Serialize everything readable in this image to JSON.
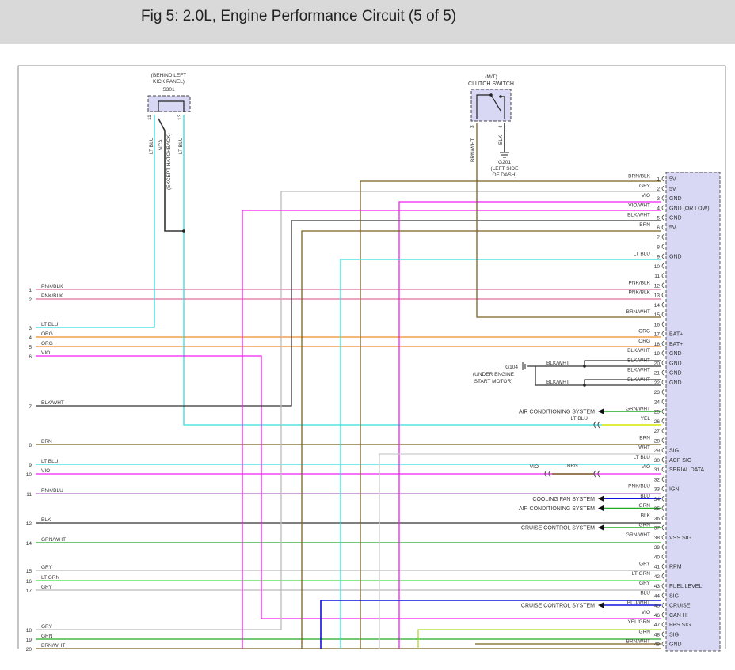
{
  "page": {
    "title": "Fig 5: 2.0L, Engine Performance Circuit (5 of 5)"
  },
  "colors": {
    "header_bg": "#d9d9d9",
    "connector_fill": "#d8d8f4",
    "PNK": "#e0709c",
    "LT_BLU": "#33dddd",
    "ORG": "#f08c28",
    "VIO": "#f01ef0",
    "BLK": "#333333",
    "BRN": "#7a6222",
    "GRN": "#22aa22",
    "GRY": "#bbbbbb",
    "WHT": "#cccccc",
    "YEL": "#e8e800",
    "LT_GRN": "#44dd44",
    "BLU": "#1111dd",
    "GRY_BLK": "#888888"
  },
  "splice_s301": {
    "label": [
      "(BEHIND LEFT",
      "KICK PANEL)",
      "S301"
    ],
    "pins": [
      "11",
      "13"
    ],
    "wires": [
      "LT BLU",
      "NCA",
      "(EXCEPT HATCHBACK)",
      "LT BLU"
    ]
  },
  "clutch_switch": {
    "label": [
      "(M/T)",
      "CLUTCH SWITCH"
    ],
    "pins": [
      "3",
      "4"
    ],
    "wires": [
      "BRN/WHT",
      "BLK"
    ],
    "ground": [
      "G201",
      "(LEFT SIDE",
      "OF DASH)"
    ]
  },
  "ground_g104": {
    "label": [
      "G104",
      "(UNDER ENGINE",
      "START MOTOR)"
    ],
    "wires": [
      "BLK/WHT",
      "BLK/WHT"
    ]
  },
  "left_pins": [
    {
      "n": "1",
      "color": "PNK/BLK"
    },
    {
      "n": "2",
      "color": "PNK/BLK"
    },
    {
      "n": "3",
      "color": "LT BLU"
    },
    {
      "n": "4",
      "color": "ORG"
    },
    {
      "n": "5",
      "color": "ORG"
    },
    {
      "n": "6",
      "color": "VIO"
    },
    {
      "n": "7",
      "color": "BLK/WHT"
    },
    {
      "n": "8",
      "color": "BRN"
    },
    {
      "n": "9",
      "color": "LT BLU"
    },
    {
      "n": "10",
      "color": "VIO"
    },
    {
      "n": "11",
      "color": "PNK/BLU"
    },
    {
      "n": "12",
      "color": "BLK"
    },
    {
      "n": "14",
      "color": "GRN/WHT"
    },
    {
      "n": "15",
      "color": "GRY"
    },
    {
      "n": "16",
      "color": "LT GRN"
    },
    {
      "n": "17",
      "color": "GRY"
    },
    {
      "n": "18",
      "color": "GRY"
    },
    {
      "n": "19",
      "color": "GRN"
    },
    {
      "n": "20",
      "color": "BRN/WHT"
    }
  ],
  "right_pins": [
    {
      "n": "1",
      "color": "BRN/BLK"
    },
    {
      "n": "2",
      "color": "GRY"
    },
    {
      "n": "3",
      "color": "VIO"
    },
    {
      "n": "4",
      "color": "VIO/WHT"
    },
    {
      "n": "5",
      "color": "BLK/WHT"
    },
    {
      "n": "6",
      "color": "BRN"
    },
    {
      "n": "7",
      "color": ""
    },
    {
      "n": "8",
      "color": ""
    },
    {
      "n": "9",
      "color": "LT BLU"
    },
    {
      "n": "10",
      "color": ""
    },
    {
      "n": "11",
      "color": ""
    },
    {
      "n": "12",
      "color": "PNK/BLK"
    },
    {
      "n": "13",
      "color": "PNK/BLK"
    },
    {
      "n": "14",
      "color": ""
    },
    {
      "n": "15",
      "color": "BRN/WHT"
    },
    {
      "n": "16",
      "color": ""
    },
    {
      "n": "17",
      "color": "ORG"
    },
    {
      "n": "18",
      "color": "ORG"
    },
    {
      "n": "19",
      "color": "BLK/WHT"
    },
    {
      "n": "20",
      "color": "BLK/WHT"
    },
    {
      "n": "21",
      "color": "BLK/WHT"
    },
    {
      "n": "22",
      "color": "BLK/WHT"
    },
    {
      "n": "23",
      "color": ""
    },
    {
      "n": "24",
      "color": ""
    },
    {
      "n": "25",
      "color": "GRN/WHT"
    },
    {
      "n": "26",
      "color": "YEL"
    },
    {
      "n": "27",
      "color": ""
    },
    {
      "n": "28",
      "color": "BRN"
    },
    {
      "n": "29",
      "color": "WHT"
    },
    {
      "n": "30",
      "color": "LT BLU"
    },
    {
      "n": "31",
      "color": "VIO"
    },
    {
      "n": "32",
      "color": ""
    },
    {
      "n": "33",
      "color": "PNK/BLU"
    },
    {
      "n": "34",
      "color": "BLU"
    },
    {
      "n": "35",
      "color": "GRN"
    },
    {
      "n": "36",
      "color": "BLK"
    },
    {
      "n": "37",
      "color": "GRN"
    },
    {
      "n": "38",
      "color": "GRN/WHT"
    },
    {
      "n": "39",
      "color": ""
    },
    {
      "n": "40",
      "color": ""
    },
    {
      "n": "41",
      "color": "GRY"
    },
    {
      "n": "42",
      "color": "LT GRN"
    },
    {
      "n": "43",
      "color": "GRY"
    },
    {
      "n": "44",
      "color": "BLU"
    },
    {
      "n": "45",
      "color": "BLU/WHT"
    },
    {
      "n": "46",
      "color": "VIO"
    },
    {
      "n": "47",
      "color": "YEL/GRN"
    },
    {
      "n": "48",
      "color": "GRN"
    },
    {
      "n": "49",
      "color": "BRN/WHT"
    }
  ],
  "pcm_functions": [
    {
      "pin": "1",
      "label": "5V"
    },
    {
      "pin": "2",
      "label": "5V"
    },
    {
      "pin": "3",
      "label": "GND"
    },
    {
      "pin": "4",
      "label": "GND (OR LOW)"
    },
    {
      "pin": "5",
      "label": "GND"
    },
    {
      "pin": "6",
      "label": "5V"
    },
    {
      "pin": "9",
      "label": "GND"
    },
    {
      "pin": "17",
      "label": "BAT+"
    },
    {
      "pin": "18",
      "label": "BAT+"
    },
    {
      "pin": "19",
      "label": "GND"
    },
    {
      "pin": "20",
      "label": "GND"
    },
    {
      "pin": "21",
      "label": "GND"
    },
    {
      "pin": "22",
      "label": "GND"
    },
    {
      "pin": "29",
      "label": "SIG"
    },
    {
      "pin": "30",
      "label": "ACP SIG"
    },
    {
      "pin": "31",
      "label": "SERIAL DATA"
    },
    {
      "pin": "33",
      "label": "IGN"
    },
    {
      "pin": "38",
      "label": "VSS SIG"
    },
    {
      "pin": "41",
      "label": "RPM"
    },
    {
      "pin": "43",
      "label": "FUEL LEVEL"
    },
    {
      "pin": "44",
      "label": "SIG"
    },
    {
      "pin": "45",
      "label": "CRUISE"
    },
    {
      "pin": "46",
      "label": "CAN HI"
    },
    {
      "pin": "47",
      "label": "FPS SIG"
    },
    {
      "pin": "48",
      "label": "SIG"
    },
    {
      "pin": "49",
      "label": "GND"
    }
  ],
  "systems": [
    {
      "pin": "25",
      "label": "AIR CONDITIONING SYSTEM"
    },
    {
      "pin": "34",
      "label": "COOLING FAN SYSTEM"
    },
    {
      "pin": "35",
      "label": "AIR CONDITIONING SYSTEM"
    },
    {
      "pin": "37",
      "label": "CRUISE CONTROL SYSTEM"
    },
    {
      "pin": "45",
      "label": "CRUISE CONTROL SYSTEM"
    }
  ],
  "inline_labels": {
    "pin26_left": "LT BLU",
    "pin31_left": "VIO",
    "pin31_mid": "BRN"
  }
}
